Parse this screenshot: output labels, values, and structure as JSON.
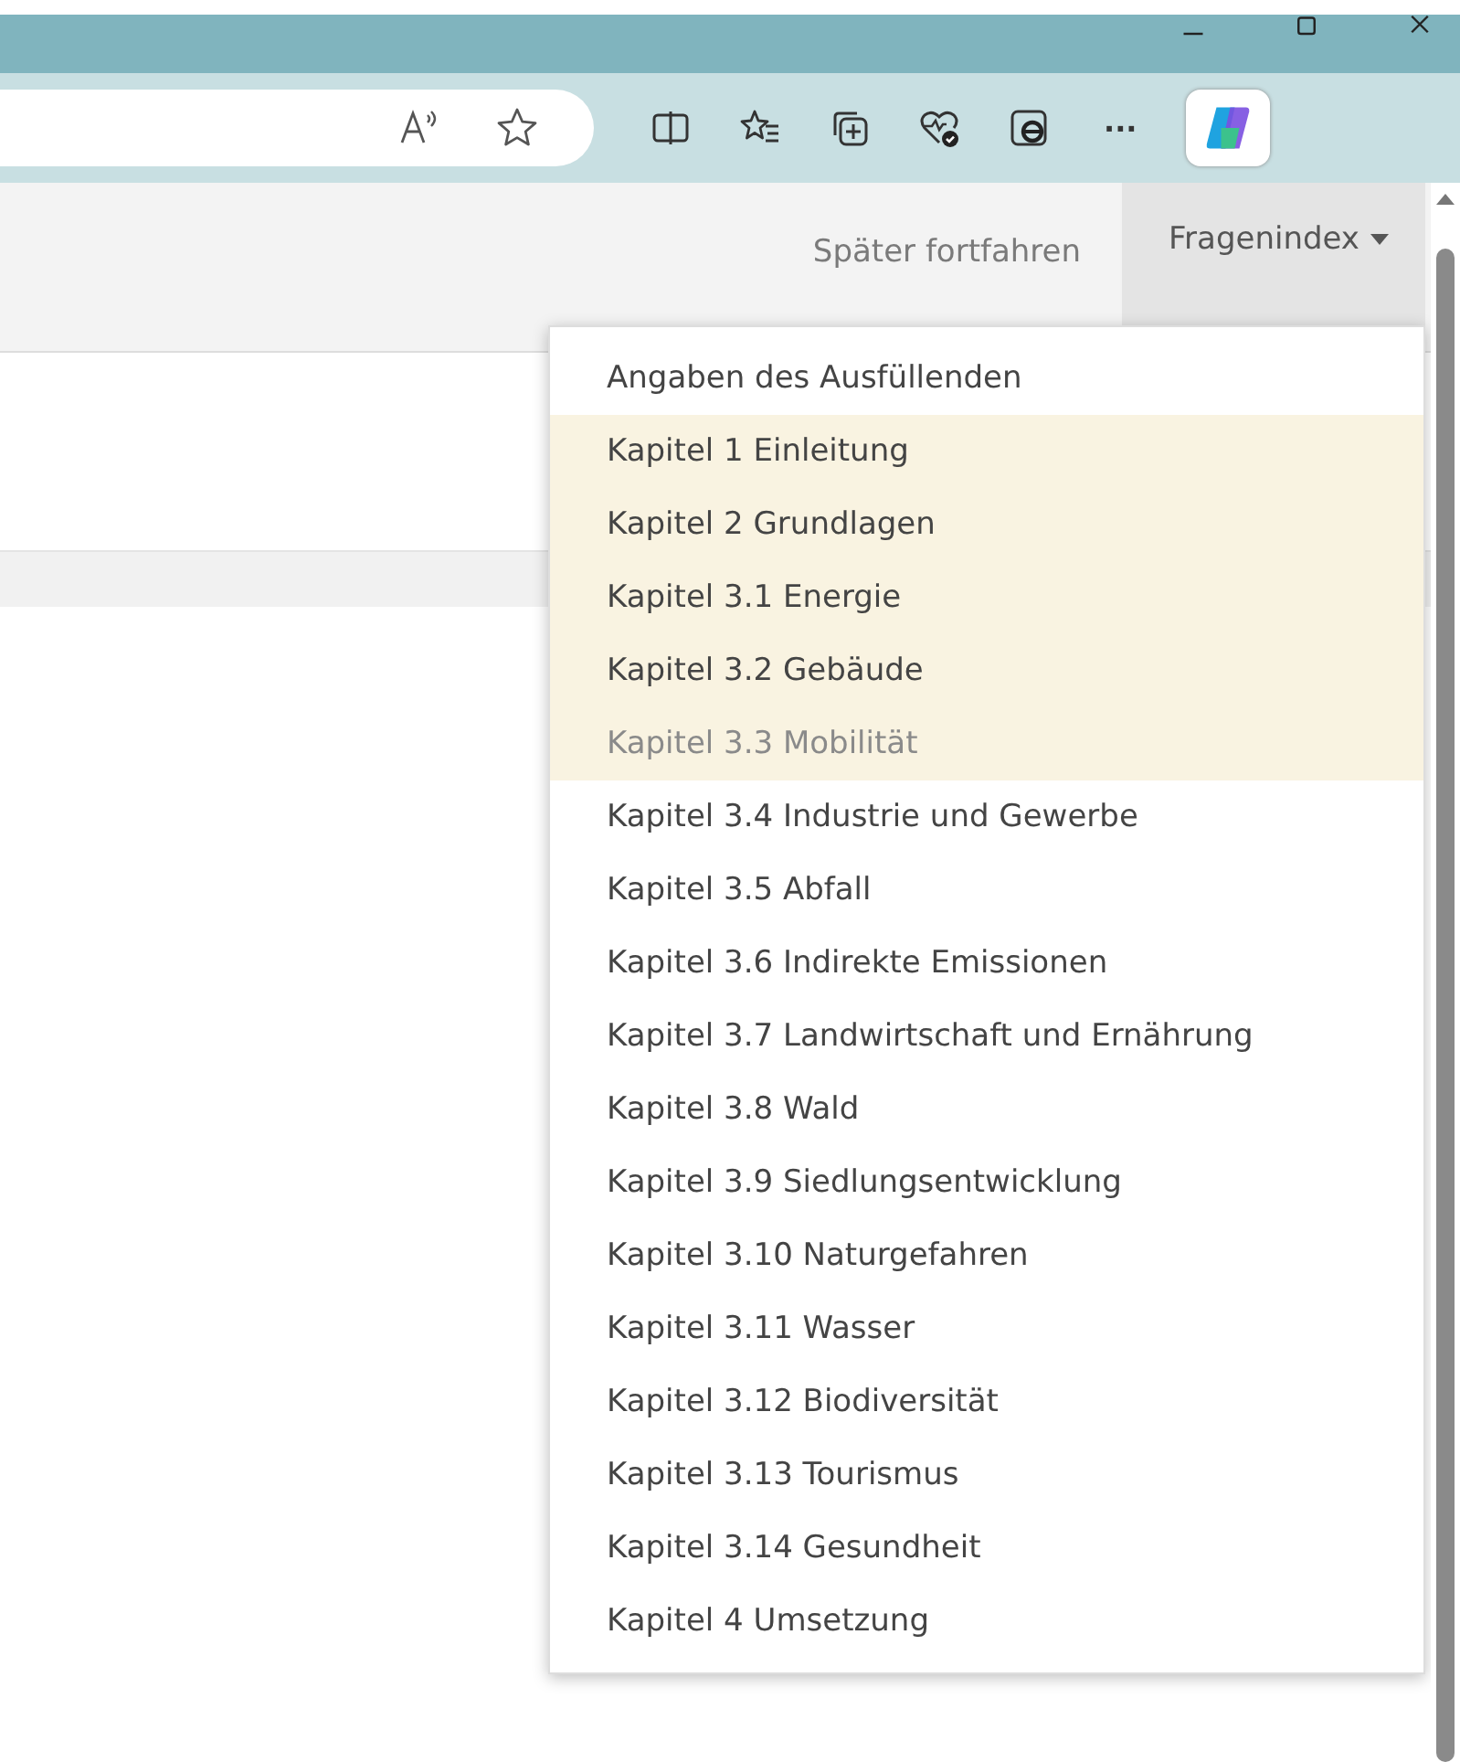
{
  "header": {
    "later_link": "Später fortfahren",
    "index_button": {
      "label": "Fragenindex",
      "expanded": true
    }
  },
  "menu": {
    "items": [
      {
        "label": "Angaben des Ausfüllenden",
        "highlighted": false,
        "muted": false
      },
      {
        "label": "Kapitel 1 Einleitung",
        "highlighted": true,
        "muted": false
      },
      {
        "label": "Kapitel 2 Grundlagen",
        "highlighted": true,
        "muted": false
      },
      {
        "label": "Kapitel 3.1 Energie",
        "highlighted": true,
        "muted": false
      },
      {
        "label": "Kapitel 3.2 Gebäude",
        "highlighted": true,
        "muted": false
      },
      {
        "label": "Kapitel 3.3 Mobilität",
        "highlighted": true,
        "muted": true
      },
      {
        "label": "Kapitel 3.4 Industrie und Gewerbe",
        "highlighted": false,
        "muted": false
      },
      {
        "label": "Kapitel 3.5 Abfall",
        "highlighted": false,
        "muted": false
      },
      {
        "label": "Kapitel 3.6 Indirekte Emissionen",
        "highlighted": false,
        "muted": false
      },
      {
        "label": "Kapitel 3.7 Landwirtschaft und Ernährung",
        "highlighted": false,
        "muted": false
      },
      {
        "label": "Kapitel 3.8 Wald",
        "highlighted": false,
        "muted": false
      },
      {
        "label": "Kapitel 3.9 Siedlungsentwicklung",
        "highlighted": false,
        "muted": false
      },
      {
        "label": "Kapitel 3.10 Naturgefahren",
        "highlighted": false,
        "muted": false
      },
      {
        "label": "Kapitel 3.11 Wasser",
        "highlighted": false,
        "muted": false
      },
      {
        "label": "Kapitel 3.12 Biodiversität",
        "highlighted": false,
        "muted": false
      },
      {
        "label": "Kapitel 3.13 Tourismus",
        "highlighted": false,
        "muted": false
      },
      {
        "label": "Kapitel 3.14 Gesundheit",
        "highlighted": false,
        "muted": false
      },
      {
        "label": "Kapitel 4 Umsetzung",
        "highlighted": false,
        "muted": false
      }
    ]
  },
  "browser": {
    "more_button": "···"
  }
}
